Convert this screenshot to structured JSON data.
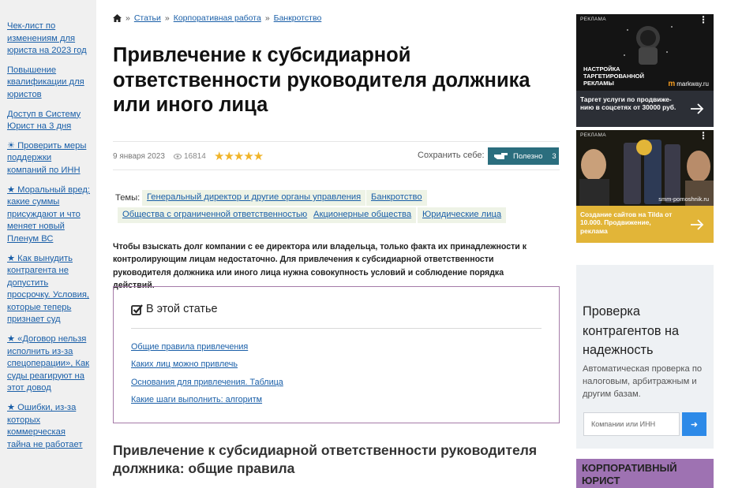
{
  "left_sidebar": {
    "links": [
      "Чек-лист по изменениям для юриста на 2023 год",
      "Повышение квалификации для юристов",
      "Доступ в Систему Юрист на 3 дня",
      "☀ Проверить меры поддержки компаний по ИНН",
      "★ Моральный вред: какие суммы присуждают и что меняет новый Пленум ВС",
      "★ Как вынудить контрагента не допустить просрочку. Условия, которые теперь признает суд",
      "★ «Договор нельзя исполнить из-за спецоперации», Как суды реагируют на этот довод",
      "★ Ошибки, из-за которых коммерческая тайна не работает"
    ]
  },
  "breadcrumb": {
    "sep": "»",
    "items": [
      "Статьи",
      "Корпоративная работа",
      "Банкротство"
    ]
  },
  "article": {
    "title": "Привлечение к субсидиарной ответственности руководителя должника или иного лица",
    "date": "9 января 2023",
    "views": "16814",
    "rating_stars": "★★★★★",
    "save_label": "Сохранить себе:",
    "useful_label": "Полезно",
    "useful_count": "3",
    "topics_label": "Темы:",
    "topics": [
      "Генеральный директор и другие органы управления",
      "Банкротство",
      "Общества с ограниченной ответственностью",
      "Акционерные общества",
      "Юридические лица"
    ],
    "lead": "Чтобы взыскать долг компании с ее директора или владельца, только факта их принадлежности к контролирующим лицам недостаточно. Для привлечения к субсидиарной ответственности руководителя должника или иного лица нужна совокупность условий и соблюдение порядка действий.",
    "toc_title": "В этой статье",
    "toc": [
      "Общие правила привлечения",
      "Каких лиц можно привлечь",
      "Основания для привлечения. Таблица",
      "Какие шаги выполнить: алгоритм"
    ],
    "section_title": "Привлечение к субсидиарной ответственности руководителя должника: общие правила"
  },
  "ads": {
    "tag": "РЕКЛАМА",
    "ad1": {
      "headline": "НАСТРОЙКА ТАРГЕТИРОВАННОЙ РЕКЛАМЫ",
      "brand": "markway.ru",
      "brand_mark": "m",
      "text": "Таргет услуги по продвиже-нию в соцсетях от 30000 руб."
    },
    "ad2": {
      "site": "smm-pomoshnik.ru",
      "text": "Создание сайтов на Tilda от 10.000. Продвижение, реклама"
    }
  },
  "check_widget": {
    "title": "Проверка контрагентов на надежность",
    "desc": "Автоматическая проверка по налоговым, арбитражным и другим базам.",
    "placeholder": "Компании или ИНН",
    "button": "➜"
  },
  "corp_box": {
    "text": "КОРПОРАТИВНЫЙ ЮРИСТ"
  },
  "colors": {
    "link": "#1a5fa8",
    "useful_button": "#2b6e7e",
    "toc_border": "#a57ba8",
    "topic_bg": "#eef3e6",
    "search_button": "#2d8ae8",
    "corp_box": "#9e72b2"
  }
}
